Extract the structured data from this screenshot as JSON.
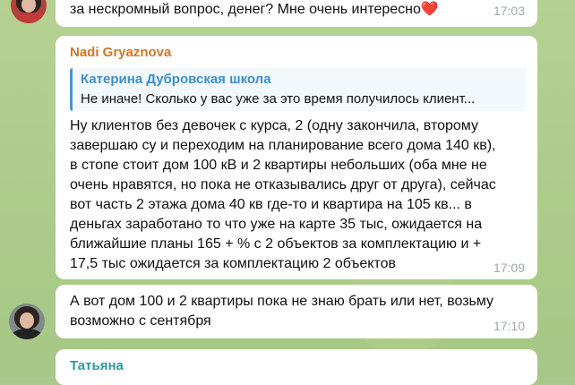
{
  "messages": {
    "top": {
      "text": "за нескромный вопрос, денег? Мне очень интересно",
      "emoji": "❤️",
      "time": "17:03"
    },
    "main": {
      "sender": "Nadi Gryaznova",
      "reply_author": "Катерина Дубровская школа",
      "reply_text": "Не иначе! Сколько у вас уже за это время получилось клиент...",
      "text": "Ну клиентов без девочек с курса, 2 (одну закончила, второму\nзавершаю су и переходим на планирование всего дома 140 кв),\nв стопе стоит дом 100 кВ и 2 квартиры небольших (оба мне не\nочень нравятся, но пока не отказывались друг от друга), сейчас\nвот часть 2 этажа дома 40 кв где-то и квартира на 105 кв... в\nденьгах заработано то что уже на карте 35 тыс, ожидается на\nближайшие планы 165 + % с 2 объектов за комплектацию и +\n17,5 тыс ожидается за комплектацию 2 объектов",
      "time": "17:09"
    },
    "followup": {
      "text": "А вот дом 100 и 2 квартиры пока не знаю брать или нет, возьму\nвозможно с сентября",
      "time": "17:10"
    },
    "next": {
      "sender": "Татьяна"
    }
  },
  "colors": {
    "sender_nadi": "#c9792c",
    "reply_accent": "#3d8fcb",
    "sender_tatyana": "#2a9b9b",
    "background": "#a9c98c"
  }
}
